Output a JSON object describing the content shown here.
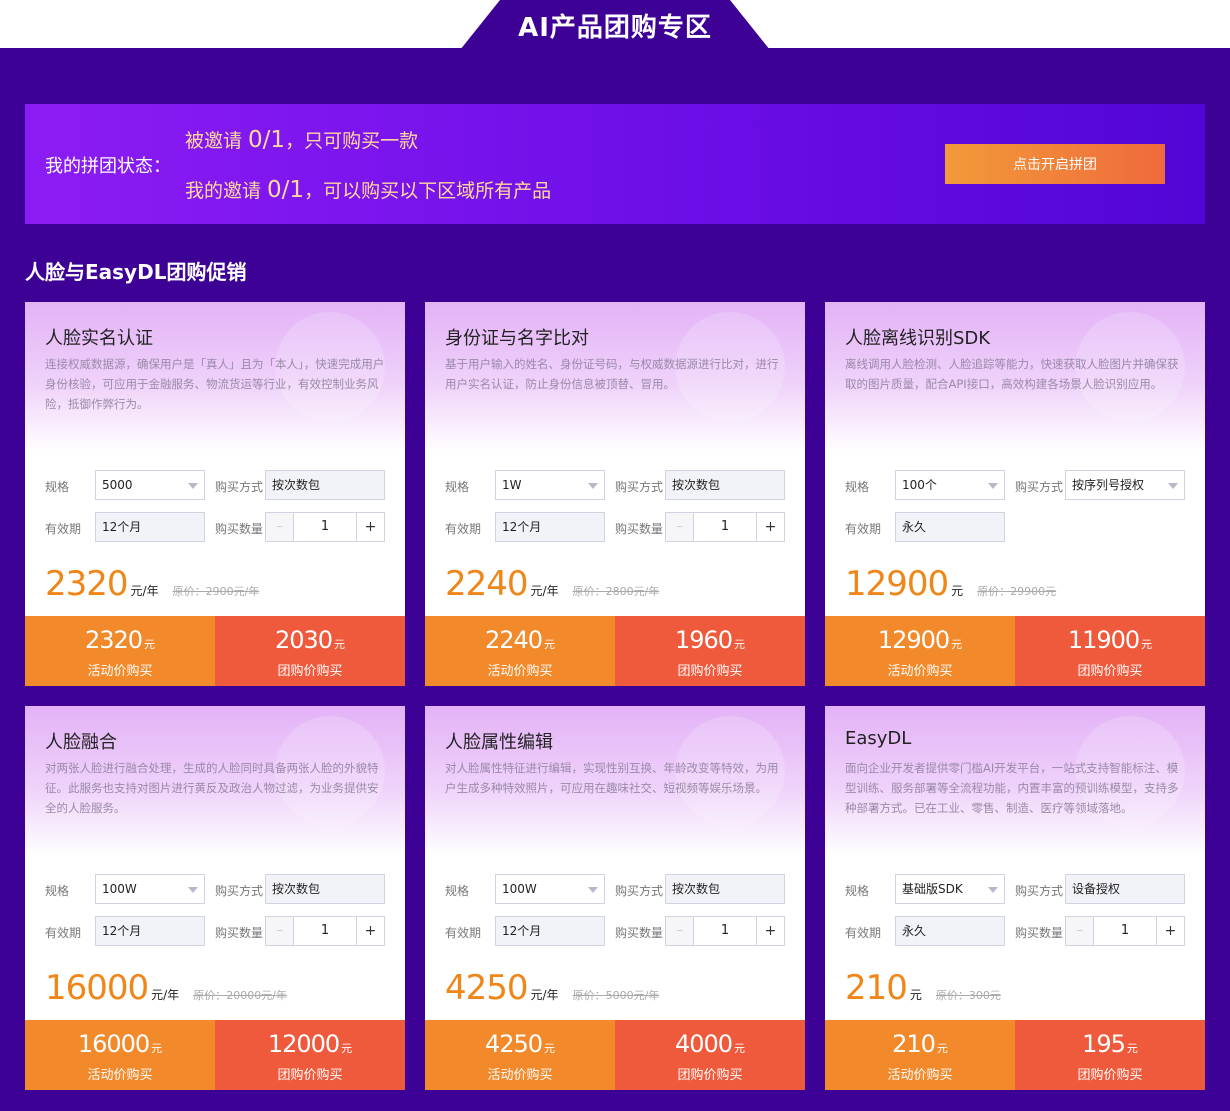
{
  "page_title": "AI产品团购专区",
  "status": {
    "label": "我的拼团状态：",
    "invited_prefix": "被邀请 ",
    "invited_count": "0/1",
    "invited_suffix": "，只可购买一款",
    "invite_prefix": "我的邀请 ",
    "invite_count": "0/1",
    "invite_suffix": "，可以购买以下区域所有产品",
    "button": "点击开启拼团"
  },
  "section_title": "人脸与EasyDL团购促销",
  "field_labels": {
    "spec": "规格",
    "buy_method": "购买方式",
    "validity": "有效期",
    "quantity": "购买数量"
  },
  "buy_labels": {
    "activity": "活动价购买",
    "group": "团购价购买",
    "yuan": "元"
  },
  "stepper": {
    "minus": "–",
    "plus": "+"
  },
  "cards": [
    {
      "title": "人脸实名认证",
      "desc": "连接权威数据源，确保用户是「真人」且为「本人」，快速完成用户身份核验，可应用于金融服务、物流货运等行业，有效控制业务风险，抵御作弊行为。",
      "spec": "5000",
      "buy_method": "按次数包",
      "buy_method_select": false,
      "validity": "12个月",
      "quantity": "1",
      "has_quantity": true,
      "price": "2320",
      "price_unit": "元/年",
      "orig_price": "原价：2900元/年",
      "activity_price": "2320",
      "group_price": "2030"
    },
    {
      "title": "身份证与名字比对",
      "desc": "基于用户输入的姓名、身份证号码，与权威数据源进行比对，进行用户实名认证，防止身份信息被顶替、冒用。",
      "spec": "1W",
      "buy_method": "按次数包",
      "buy_method_select": false,
      "validity": "12个月",
      "quantity": "1",
      "has_quantity": true,
      "price": "2240",
      "price_unit": "元/年",
      "orig_price": "原价：2800元/年",
      "activity_price": "2240",
      "group_price": "1960"
    },
    {
      "title": "人脸离线识别SDK",
      "desc": "离线调用人脸检测、人脸追踪等能力，快速获取人脸图片并确保获取的图片质量，配合API接口，高效构建各场景人脸识别应用。",
      "spec": "100个",
      "buy_method": "按序列号授权",
      "buy_method_select": true,
      "validity": "永久",
      "quantity": "",
      "has_quantity": false,
      "price": "12900",
      "price_unit": "元",
      "orig_price": "原价：29900元",
      "activity_price": "12900",
      "group_price": "11900"
    },
    {
      "title": "人脸融合",
      "desc": "对两张人脸进行融合处理，生成的人脸同时具备两张人脸的外貌特征。此服务也支持对图片进行黄反及政治人物过滤，为业务提供安全的人脸服务。",
      "spec": "100W",
      "buy_method": "按次数包",
      "buy_method_select": false,
      "validity": "12个月",
      "quantity": "1",
      "has_quantity": true,
      "price": "16000",
      "price_unit": "元/年",
      "orig_price": "原价：20000元/年",
      "activity_price": "16000",
      "group_price": "12000"
    },
    {
      "title": "人脸属性编辑",
      "desc": "对人脸属性特征进行编辑，实现性别互换、年龄改变等特效，为用户生成多种特效照片，可应用在趣味社交、短视频等娱乐场景。",
      "spec": "100W",
      "buy_method": "按次数包",
      "buy_method_select": false,
      "validity": "12个月",
      "quantity": "1",
      "has_quantity": true,
      "price": "4250",
      "price_unit": "元/年",
      "orig_price": "原价：5000元/年",
      "activity_price": "4250",
      "group_price": "4000"
    },
    {
      "title": "EasyDL",
      "desc": "面向企业开发者提供零门槛AI开发平台，一站式支持智能标注、模型训练、服务部署等全流程功能，内置丰富的预训练模型，支持多种部署方式。已在工业、零售、制造、医疗等领域落地。",
      "spec": "基础版SDK",
      "buy_method": "设备授权",
      "buy_method_select": false,
      "validity": "永久",
      "quantity": "1",
      "has_quantity": true,
      "price": "210",
      "price_unit": "元",
      "orig_price": "原价：300元",
      "activity_price": "210",
      "group_price": "195"
    }
  ],
  "colors": {
    "background": "#3e0195",
    "price": "#f08518",
    "activity_button": "#f28a2c",
    "group_button": "#f05a3c",
    "status_text": "#ffd99c"
  }
}
